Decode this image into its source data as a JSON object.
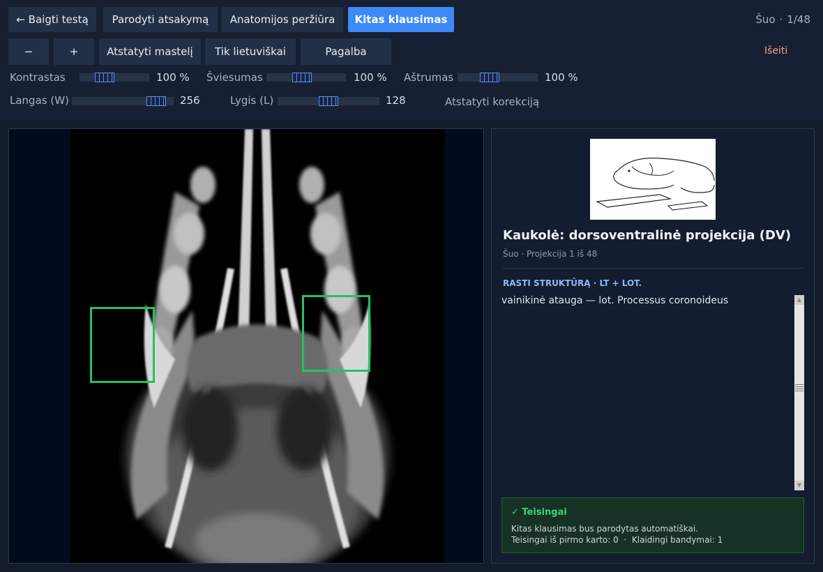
{
  "toolbar": {
    "end_test": "← Baigti testą",
    "show_answer": "Parodyti atsakymą",
    "anatomy_review": "Anatomijos peržiūra",
    "next_question": "Kitas klausimas",
    "zoom_out": "−",
    "zoom_in": "+",
    "reset_zoom": "Atstatyti mastelį",
    "lt_only": "Tik lietuviškai",
    "help": "Pagalba",
    "exit": "Išeiti",
    "species": "Šuo",
    "separator": "·",
    "progress": "1/48"
  },
  "adjust": {
    "contrast": {
      "label": "Kontrastas",
      "value": "100 %",
      "level": 0.3
    },
    "brightness": {
      "label": "Šviesumas",
      "value": "100 %",
      "level": 0.43
    },
    "sharpness": {
      "label": "Aštrumas",
      "value": "100 %",
      "level": 0.37
    },
    "window": {
      "label": "Langas (W)",
      "value": "256",
      "level": 0.91
    },
    "level": {
      "label": "Lygis (L)",
      "value": "128",
      "level": 0.5
    },
    "reset_correction": "Atstatyti korekciją"
  },
  "panel": {
    "title": "Kaukolė: dorsoventralinė projekcija (DV)",
    "subtitle": "Šuo · Projekcija 1 iš 48",
    "section_label": "RASTI STRUKTŪRĄ · LT + LOT.",
    "answer": "vainikinė atauga — lot. Processus coronoideus",
    "result_title": "✓ Teisingai",
    "result_line1": "Kitas klausimas bus parodytas automatiškai.",
    "result_line2": "Teisingai iš pirmo karto: 0  ·  Klaidingi bandymai: 1"
  },
  "colors": {
    "accent": "#3d8af7",
    "highlight": "#22c35e",
    "exit": "#f3a39a",
    "success": "#3ed27a"
  }
}
